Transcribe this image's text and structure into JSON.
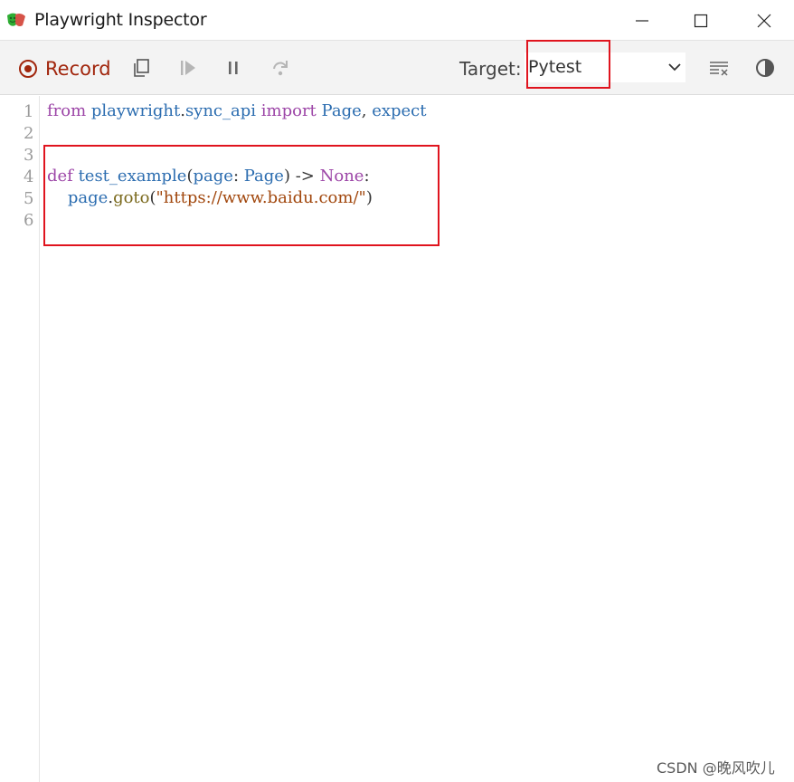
{
  "window": {
    "title": "Playwright Inspector",
    "app_icon": "playwright-masks-icon",
    "controls": [
      "minimize-icon",
      "maximize-icon",
      "close-icon"
    ]
  },
  "toolbar": {
    "record_label": "Record",
    "icons": [
      "record-icon",
      "copy-icon",
      "resume-icon",
      "pause-icon",
      "step-over-icon",
      "clear-icon",
      "theme-toggle-icon"
    ],
    "target_label": "Target:",
    "target_value": "Pytest",
    "record_color": "#a1260d"
  },
  "editor": {
    "line_numbers": [
      "1",
      "2",
      "3",
      "4",
      "5",
      "6"
    ],
    "lines": [
      {
        "tokens": [
          {
            "text": "from ",
            "cls": "kw"
          },
          {
            "text": "playwright",
            "cls": "fn"
          },
          {
            "text": ".",
            "cls": "plain"
          },
          {
            "text": "sync_api",
            "cls": "fn"
          },
          {
            "text": " ",
            "cls": "plain"
          },
          {
            "text": "import",
            "cls": "kw"
          },
          {
            "text": " ",
            "cls": "plain"
          },
          {
            "text": "Page",
            "cls": "fn"
          },
          {
            "text": ", ",
            "cls": "plain"
          },
          {
            "text": "expect",
            "cls": "fn"
          }
        ]
      },
      {
        "tokens": []
      },
      {
        "tokens": []
      },
      {
        "tokens": [
          {
            "text": "def ",
            "cls": "kw"
          },
          {
            "text": "test_example",
            "cls": "fn"
          },
          {
            "text": "(",
            "cls": "plain"
          },
          {
            "text": "page",
            "cls": "fn"
          },
          {
            "text": ": ",
            "cls": "plain"
          },
          {
            "text": "Page",
            "cls": "fn"
          },
          {
            "text": ") ",
            "cls": "plain"
          },
          {
            "text": "->",
            "cls": "plain"
          },
          {
            "text": " ",
            "cls": "plain"
          },
          {
            "text": "None",
            "cls": "kw"
          },
          {
            "text": ":",
            "cls": "plain"
          }
        ]
      },
      {
        "tokens": [
          {
            "text": "    ",
            "cls": "plain"
          },
          {
            "text": "page",
            "cls": "fn"
          },
          {
            "text": ".",
            "cls": "plain"
          },
          {
            "text": "goto",
            "cls": "call"
          },
          {
            "text": "(",
            "cls": "plain"
          },
          {
            "text": "\"https://www.baidu.com/\"",
            "cls": "str"
          },
          {
            "text": ")",
            "cls": "plain"
          }
        ]
      },
      {
        "tokens": []
      }
    ]
  },
  "annotations": {
    "highlight_color": "#e0141e"
  },
  "watermark": "CSDN @晚风吹儿"
}
